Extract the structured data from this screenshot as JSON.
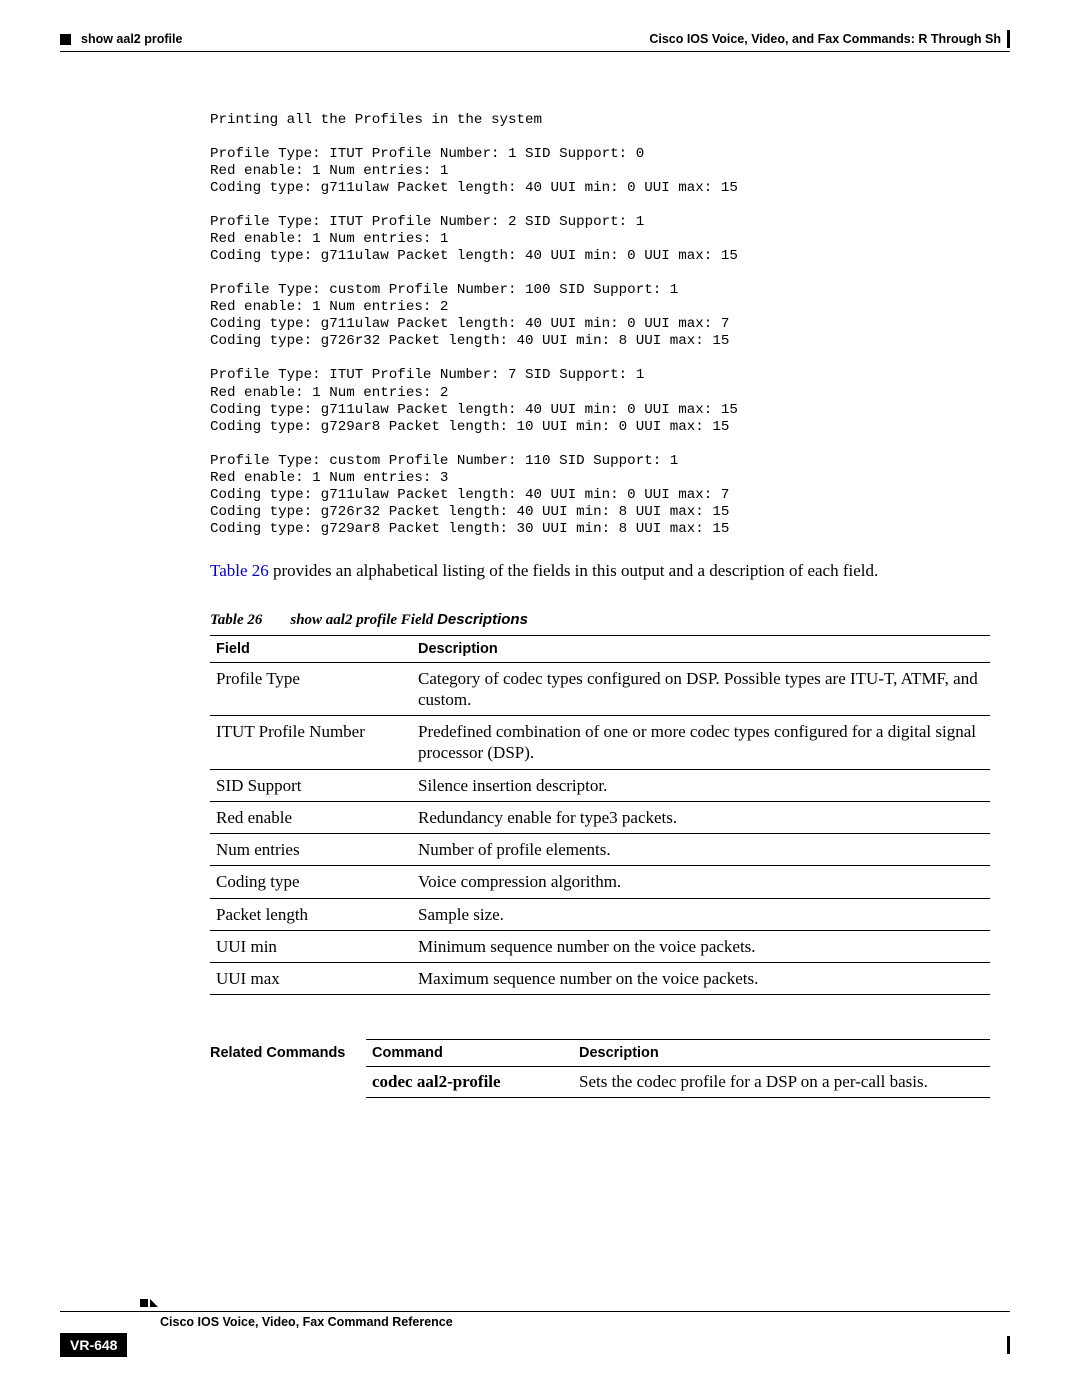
{
  "header": {
    "left_title": "show aal2 profile",
    "right_title": "Cisco IOS Voice, Video, and Fax Commands: R Through Sh"
  },
  "code_lines": [
    "Printing all the Profiles in the system",
    "",
    "Profile Type: ITUT Profile Number: 1 SID Support: 0",
    "Red enable: 1 Num entries: 1",
    "Coding type: g711ulaw Packet length: 40 UUI min: 0 UUI max: 15",
    "",
    "Profile Type: ITUT Profile Number: 2 SID Support: 1",
    "Red enable: 1 Num entries: 1",
    "Coding type: g711ulaw Packet length: 40 UUI min: 0 UUI max: 15",
    "",
    "Profile Type: custom Profile Number: 100 SID Support: 1",
    "Red enable: 1 Num entries: 2",
    "Coding type: g711ulaw Packet length: 40 UUI min: 0 UUI max: 7",
    "Coding type: g726r32 Packet length: 40 UUI min: 8 UUI max: 15",
    "",
    "Profile Type: ITUT Profile Number: 7 SID Support: 1",
    "Red enable: 1 Num entries: 2",
    "Coding type: g711ulaw Packet length: 40 UUI min: 0 UUI max: 15",
    "Coding type: g729ar8 Packet length: 10 UUI min: 0 UUI max: 15",
    "",
    "Profile Type: custom Profile Number: 110 SID Support: 1",
    "Red enable: 1 Num entries: 3",
    "Coding type: g711ulaw Packet length: 40 UUI min: 0 UUI max: 7",
    "Coding type: g726r32 Packet length: 40 UUI min: 8 UUI max: 15",
    "Coding type: g729ar8 Packet length: 30 UUI min: 8 UUI max: 15"
  ],
  "intro_para": {
    "link": "Table 26",
    "rest": " provides an alphabetical listing of the fields in this output and a description of each field."
  },
  "table_caption": {
    "label": "Table 26",
    "title_prefix": "show aal2 profile Field ",
    "title_suffix": "Descriptions"
  },
  "fields_table": {
    "headers": [
      "Field",
      "Description"
    ],
    "rows": [
      [
        "Profile Type",
        "Category of codec types configured on DSP. Possible types are ITU-T, ATMF, and custom."
      ],
      [
        "ITUT Profile Number",
        "Predefined combination of one or more codec types configured for a digital signal processor (DSP)."
      ],
      [
        "SID Support",
        "Silence insertion descriptor."
      ],
      [
        "Red enable",
        "Redundancy enable for type3 packets."
      ],
      [
        "Num entries",
        "Number of profile elements."
      ],
      [
        "Coding type",
        "Voice compression algorithm."
      ],
      [
        "Packet length",
        "Sample size."
      ],
      [
        "UUI min",
        "Minimum sequence number on the voice packets."
      ],
      [
        "UUI max",
        "Maximum sequence number on the voice packets."
      ]
    ]
  },
  "related": {
    "label": "Related Commands",
    "headers": [
      "Command",
      "Description"
    ],
    "rows": [
      [
        "codec aal2-profile",
        "Sets the codec profile for a DSP on a per-call basis."
      ]
    ]
  },
  "footer": {
    "title": "Cisco IOS Voice, Video, Fax Command Reference",
    "page": "VR-648"
  }
}
